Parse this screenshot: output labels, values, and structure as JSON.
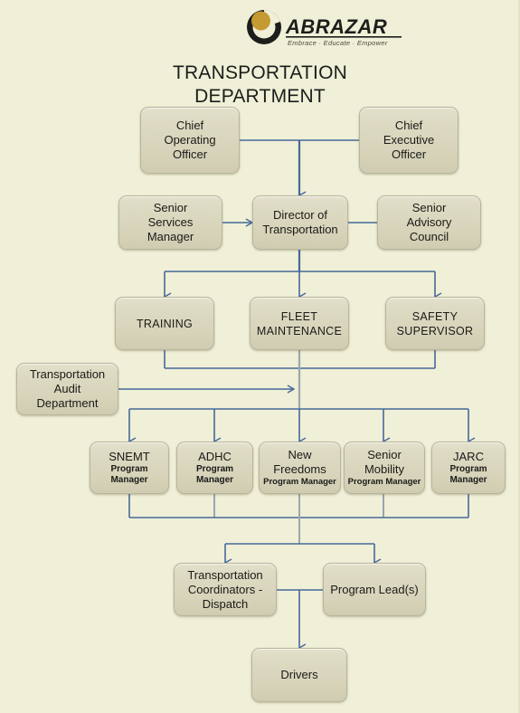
{
  "logo": {
    "wordmark": "ABRAZAR",
    "tagline": "Embrace · Educate · Empower",
    "mark_name": "abrazar-circle-mark",
    "colors": {
      "dark": "#1d1d1b",
      "gold": "#c59a32"
    }
  },
  "title": {
    "line1": "TRANSPORTATION",
    "line2": "DEPARTMENT"
  },
  "theme": {
    "page_background": "#f0efd7",
    "node_fill": "#d8d5bd",
    "node_border": "#b8b59b",
    "connector": "#46699a",
    "text": "#1a1a17"
  },
  "chart_data": {
    "type": "diagram",
    "subtype": "organization-chart",
    "title": "TRANSPORTATION DEPARTMENT",
    "nodes": [
      {
        "id": "coo",
        "label": "Chief Operating Officer",
        "lines": [
          "Chief",
          "Operating",
          "Officer"
        ]
      },
      {
        "id": "ceo",
        "label": "Chief Executive Officer",
        "lines": [
          "Chief",
          "Executive",
          "Officer"
        ]
      },
      {
        "id": "ssm",
        "label": "Senior Services Manager",
        "lines": [
          "Senior",
          "Services",
          "Manager"
        ]
      },
      {
        "id": "dot",
        "label": "Director of Transportation",
        "lines": [
          "Director of",
          "Transportation"
        ]
      },
      {
        "id": "sac",
        "label": "Senior Advisory Council",
        "lines": [
          "Senior",
          "Advisory",
          "Council"
        ]
      },
      {
        "id": "train",
        "label": "TRAINING",
        "lines": [
          "TRAINING"
        ]
      },
      {
        "id": "fleet",
        "label": "FLEET MAINTENANCE",
        "lines": [
          "FLEET",
          "MAINTENANCE"
        ]
      },
      {
        "id": "safety",
        "label": "SAFETY SUPERVISOR",
        "lines": [
          "SAFETY",
          "SUPERVISOR"
        ]
      },
      {
        "id": "audit",
        "label": "Transportation Audit Department",
        "lines": [
          "Transportation",
          "Audit",
          "Department"
        ]
      },
      {
        "id": "snemt",
        "label": "SNEMT Program Manager",
        "lines": [
          "SNEMT"
        ],
        "sub": [
          "Program",
          "Manager"
        ]
      },
      {
        "id": "adhc",
        "label": "ADHC Program Manager",
        "lines": [
          "ADHC"
        ],
        "sub": [
          "Program",
          "Manager"
        ]
      },
      {
        "id": "newf",
        "label": "New Freedoms Program Manager",
        "lines": [
          "New",
          "Freedoms"
        ],
        "sub": [
          "Program Manager"
        ]
      },
      {
        "id": "senmob",
        "label": "Senior Mobility Program Manager",
        "lines": [
          "Senior",
          "Mobility"
        ],
        "sub": [
          "Program Manager"
        ]
      },
      {
        "id": "jarc",
        "label": "JARC Program Manager",
        "lines": [
          "JARC"
        ],
        "sub": [
          "Program",
          "Manager"
        ]
      },
      {
        "id": "coord",
        "label": "Transportation Coordinators - Dispatch",
        "lines": [
          "Transportation",
          "Coordinators -",
          "Dispatch"
        ]
      },
      {
        "id": "lead",
        "label": "Program Lead(s)",
        "lines": [
          "Program Lead(s)"
        ]
      },
      {
        "id": "driver",
        "label": "Drivers",
        "lines": [
          "Drivers"
        ]
      }
    ],
    "edges": [
      {
        "from": "coo",
        "to": "dot",
        "style": "elbow"
      },
      {
        "from": "ceo",
        "to": "dot",
        "style": "elbow"
      },
      {
        "from": "ssm",
        "to": "dot",
        "style": "arrow-right"
      },
      {
        "from": "sac",
        "to": "dot",
        "style": "arrow-left"
      },
      {
        "from": "dot",
        "to": "train",
        "style": "fan"
      },
      {
        "from": "dot",
        "to": "fleet",
        "style": "fan"
      },
      {
        "from": "dot",
        "to": "safety",
        "style": "fan"
      },
      {
        "from": "train",
        "to": "trunk",
        "style": "merge"
      },
      {
        "from": "fleet",
        "to": "trunk",
        "style": "merge"
      },
      {
        "from": "safety",
        "to": "trunk",
        "style": "merge"
      },
      {
        "from": "audit",
        "to": "trunk",
        "style": "arrow-right"
      },
      {
        "from": "trunk",
        "to": "snemt",
        "style": "fan"
      },
      {
        "from": "trunk",
        "to": "adhc",
        "style": "fan"
      },
      {
        "from": "trunk",
        "to": "newf",
        "style": "fan"
      },
      {
        "from": "trunk",
        "to": "senmob",
        "style": "fan"
      },
      {
        "from": "trunk",
        "to": "jarc",
        "style": "fan"
      },
      {
        "from": "snemt",
        "to": "trunk2",
        "style": "merge"
      },
      {
        "from": "adhc",
        "to": "trunk2",
        "style": "merge"
      },
      {
        "from": "newf",
        "to": "trunk2",
        "style": "merge"
      },
      {
        "from": "senmob",
        "to": "trunk2",
        "style": "merge"
      },
      {
        "from": "jarc",
        "to": "trunk2",
        "style": "merge"
      },
      {
        "from": "trunk2",
        "to": "coord",
        "style": "fan"
      },
      {
        "from": "trunk2",
        "to": "lead",
        "style": "fan"
      },
      {
        "from": "coord",
        "to": "driver",
        "style": "elbow"
      },
      {
        "from": "lead",
        "to": "driver",
        "style": "elbow"
      }
    ]
  }
}
